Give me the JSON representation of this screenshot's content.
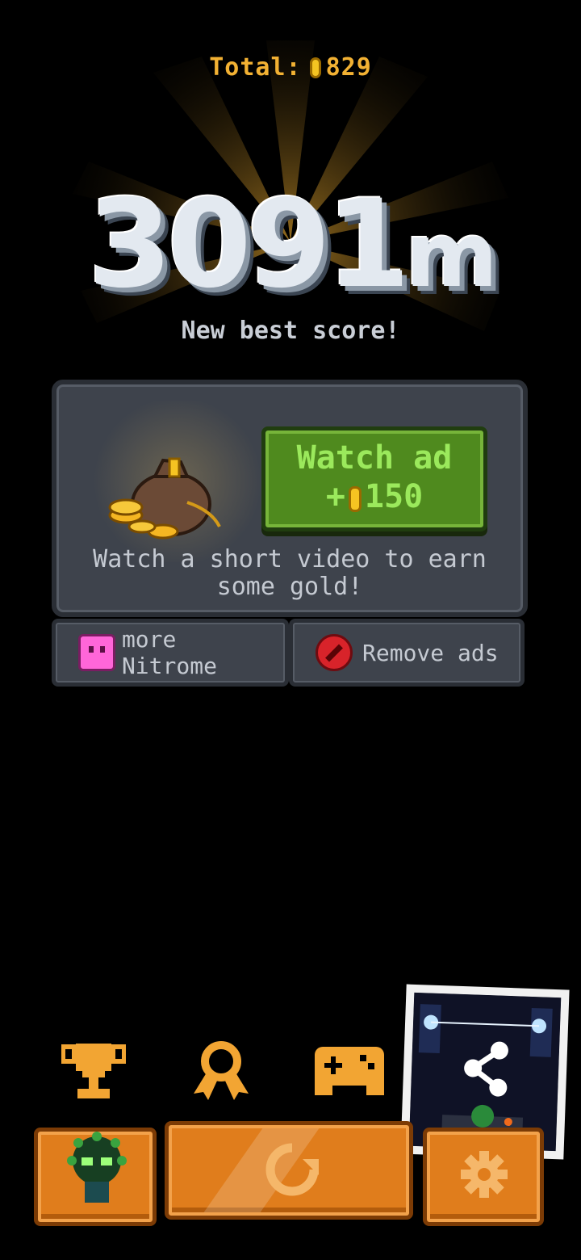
{
  "header": {
    "total_label": "Total:",
    "total_value": "829",
    "score_value": "3091",
    "score_unit": "m",
    "best_label": "New best score!"
  },
  "reward_panel": {
    "watch_line1": "Watch ad",
    "watch_plus": "+",
    "watch_amount": "150",
    "description_line1": "Watch a short video to earn",
    "description_line2": "some gold!"
  },
  "links": {
    "more_nitrome": "more Nitrome",
    "remove_ads": "Remove ads"
  },
  "colors": {
    "gold": "#f2b133",
    "orange_button": "#e07d1c",
    "green_button": "#4f8a1e",
    "panel": "#3e434c"
  },
  "icons": [
    "trophy-icon",
    "achievement-ribbon-icon",
    "gamepad-icon",
    "share-icon",
    "character-icon",
    "restart-icon",
    "gear-icon"
  ]
}
